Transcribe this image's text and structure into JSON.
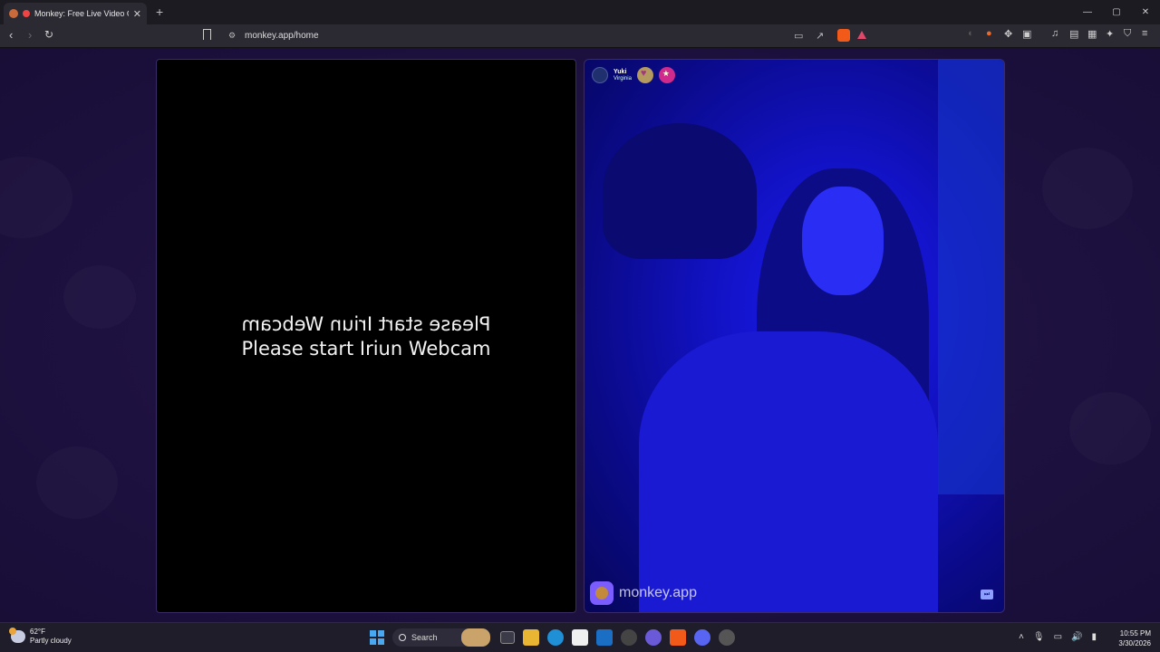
{
  "browser": {
    "tab_title": "Monkey: Free Live Video Chat",
    "tab_close": "✕",
    "new_tab": "+",
    "url": "monkey.app/home",
    "window_controls": {
      "minimize": "—",
      "maximize": "▢",
      "close": "✕"
    }
  },
  "page": {
    "left_panel": {
      "message_mirrored": "Please start Iriun Webcam",
      "message": "Please start Iriun Webcam"
    },
    "right_panel": {
      "user_name": "Yuki",
      "user_location": "Virginia",
      "watermark": "monkey.app"
    }
  },
  "taskbar": {
    "weather_temp": "62°F",
    "weather_desc": "Partly cloudy",
    "search_label": "Search",
    "time": "10:55 PM",
    "date": "3/30/2026"
  }
}
